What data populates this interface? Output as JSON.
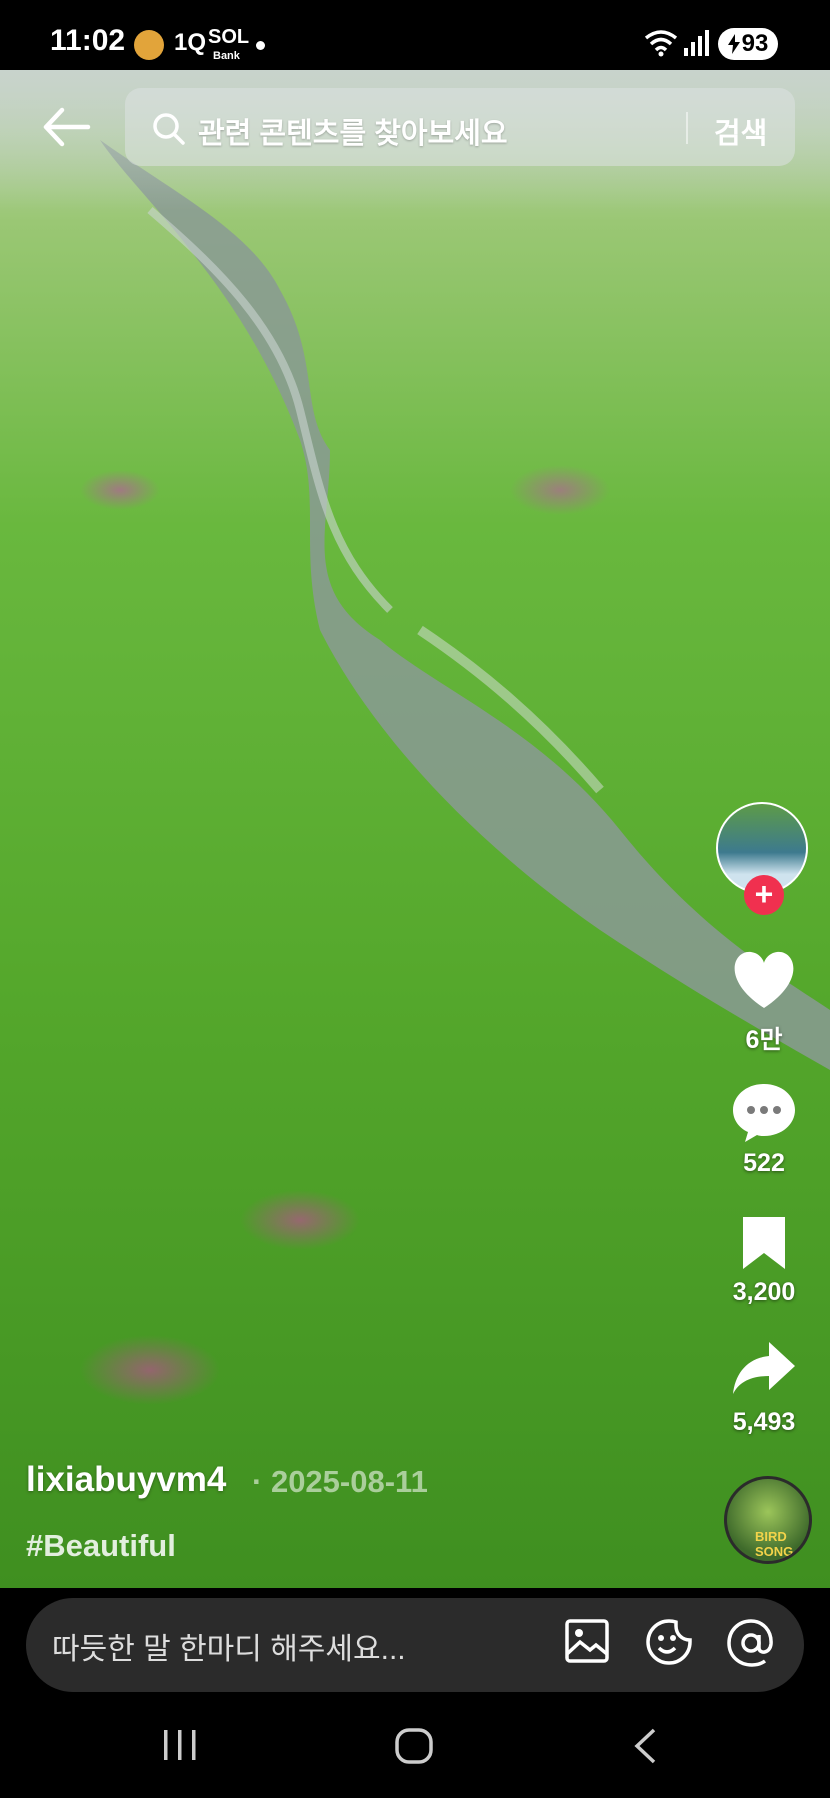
{
  "status_bar": {
    "time": "11:02",
    "app_indicators": [
      "1Q",
      "SOL"
    ],
    "bank_label": "Bank",
    "battery": "93"
  },
  "search": {
    "placeholder": "관련 콘텐츠를 찾아보세요",
    "button_label": "검색"
  },
  "actions": {
    "likes": "6만",
    "comments": "522",
    "saves": "3,200",
    "shares": "5,493"
  },
  "post": {
    "author": "lixiabuyvm4",
    "separator": "·",
    "date": "2025-08-11",
    "hashtag": "#Beautiful"
  },
  "music_disc_text": "BIRD SONG",
  "comment": {
    "placeholder": "따듯한 말 한마디 해주세요..."
  },
  "icons": [
    "back-arrow-icon",
    "search-icon",
    "heart-icon",
    "comment-icon",
    "bookmark-icon",
    "share-icon",
    "image-icon",
    "emoji-icon",
    "mention-icon",
    "recent-apps-icon",
    "home-icon",
    "back-nav-icon"
  ],
  "colors": {
    "follow_red": "#f0304f",
    "comment_box": "#2b2b2b",
    "background": "#000000"
  }
}
